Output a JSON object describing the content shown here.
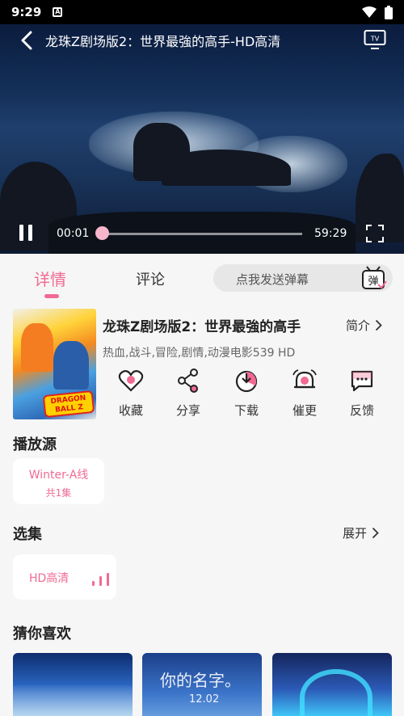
{
  "status_bar": {
    "time": "9:29",
    "notif_badge": "A"
  },
  "player": {
    "title": "龙珠Z剧场版2：世界最強的高手-HD高清",
    "current_time": "00:01",
    "total_time": "59:29",
    "progress_fraction": 0.0003
  },
  "tabs": {
    "detail": "详情",
    "comments": "评论"
  },
  "danmaku": {
    "placeholder": "点我发送弹幕",
    "icon_text": "弹"
  },
  "video": {
    "title": "龙珠Z剧场版2：世界最強的高手",
    "intro_label": "简介",
    "tags": "热血,战斗,冒险,剧情,动漫电影539 HD",
    "poster_logo": "DRAGON BALL Z"
  },
  "actions": [
    {
      "label": "收藏",
      "icon": "heart-icon"
    },
    {
      "label": "分享",
      "icon": "share-icon"
    },
    {
      "label": "下载",
      "icon": "download-icon"
    },
    {
      "label": "催更",
      "icon": "bell-icon"
    },
    {
      "label": "反馈",
      "icon": "feedback-icon"
    }
  ],
  "sources": {
    "title": "播放源",
    "items": [
      {
        "name": "Winter-A线",
        "count": "共1集"
      }
    ]
  },
  "episodes": {
    "title": "选集",
    "expand_label": "展开",
    "items": [
      {
        "label": "HD高清"
      }
    ]
  },
  "recommend": {
    "title": "猜你喜欢",
    "items": [
      {
        "caption": ""
      },
      {
        "caption": "你的名字。",
        "date": "12.02"
      },
      {
        "caption": ""
      }
    ]
  },
  "colors": {
    "accent": "#f06a93",
    "background": "#f6f6f6"
  }
}
